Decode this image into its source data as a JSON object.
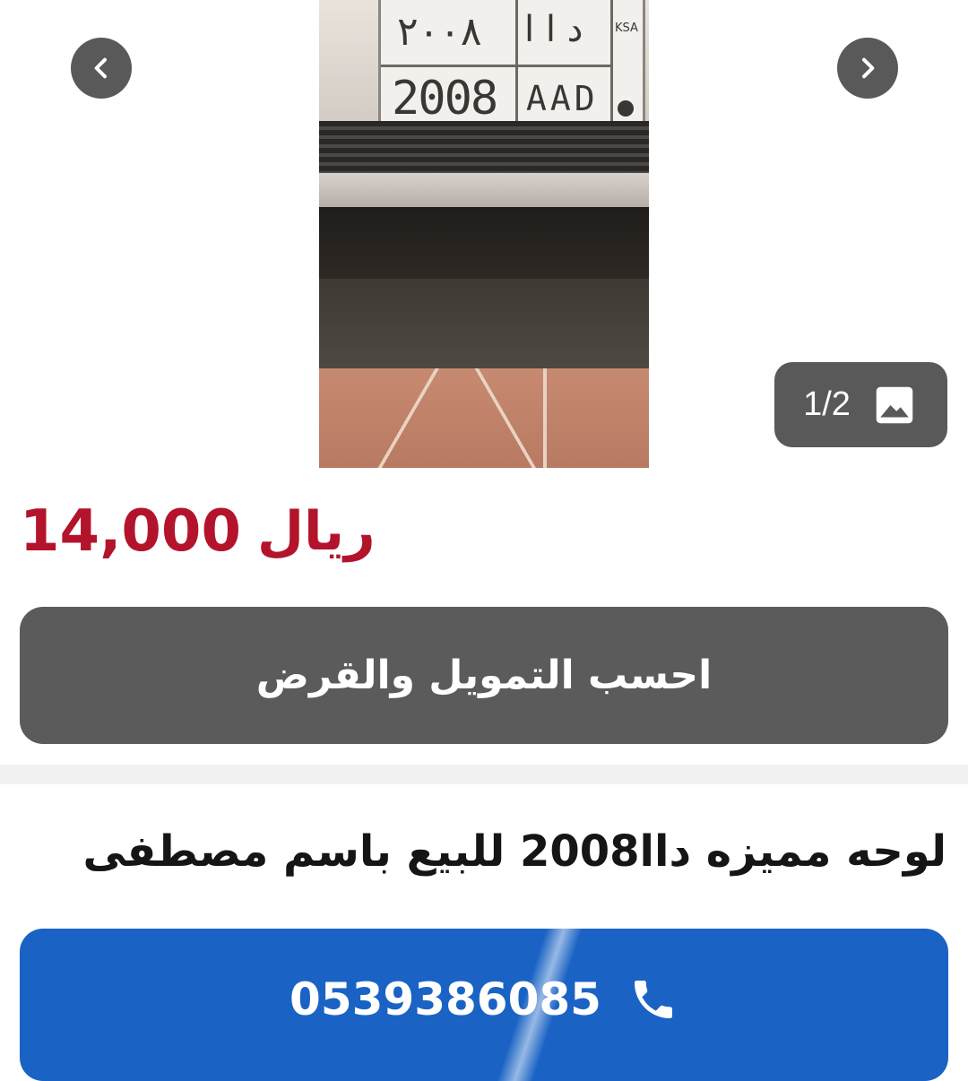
{
  "gallery": {
    "counter": "1/2",
    "counter_icon": "image-icon",
    "prev_icon": "chevron-left-icon",
    "next_icon": "chevron-right-icon",
    "photo": {
      "plate_number_en": "2008",
      "plate_letters_en": "AAD",
      "plate_number_ar": "٢٠٠٨",
      "plate_letters_ar": "د ا ا",
      "plate_country": "KSA"
    }
  },
  "listing": {
    "price_value": "14,000",
    "price_currency": "ريال",
    "price_color": "#b3142b",
    "finance_button": "احسب التمويل والقرض",
    "title": "لوحه مميزه داا2008 للبيع باسم مصطفى",
    "phone": "0539386085",
    "phone_icon": "phone-icon",
    "call_button_color": "#1a63c4"
  }
}
